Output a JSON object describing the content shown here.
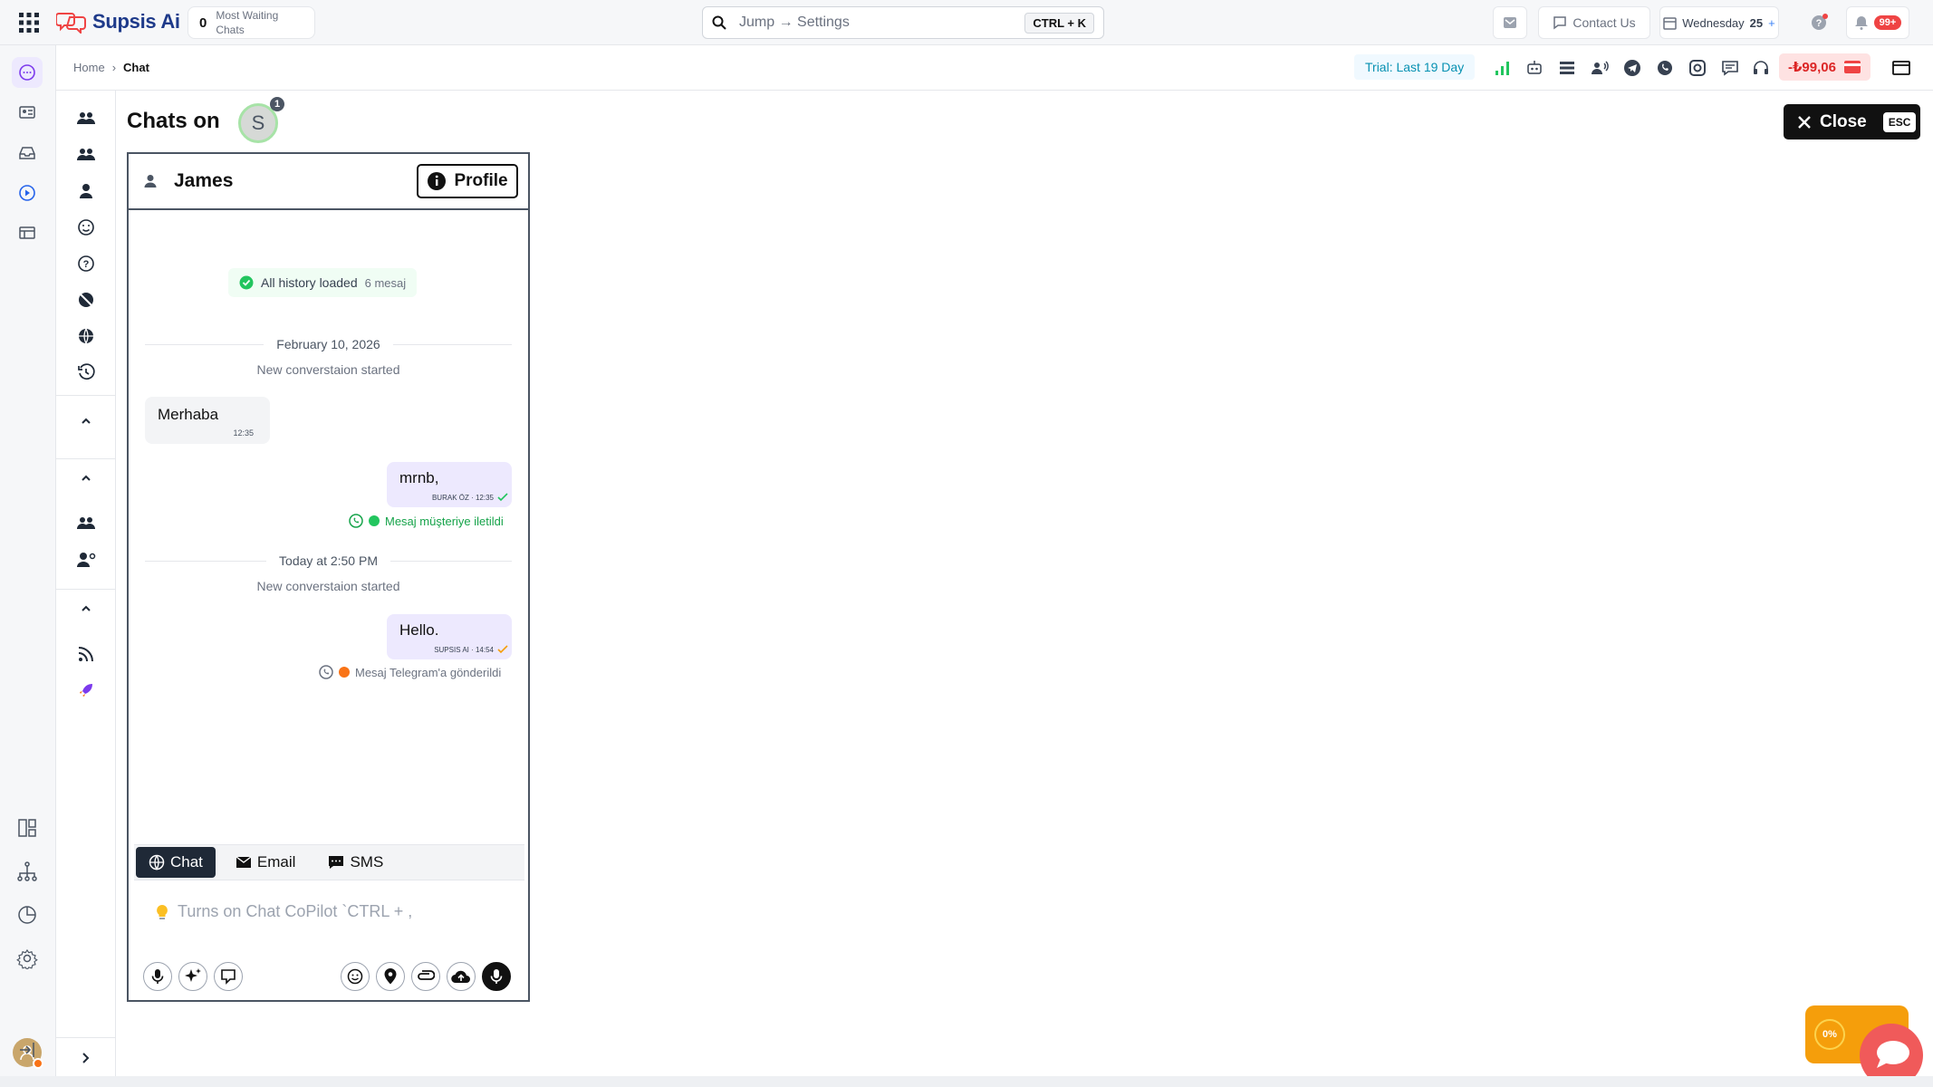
{
  "app": {
    "brand": "Supsis Ai"
  },
  "topbar": {
    "waiting_count": "0",
    "waiting_label": "Most Waiting Chats",
    "search_placeholder": "Jump → Settings",
    "search_shortcut": "CTRL + K",
    "contact_label": "Contact Us",
    "date_label": "Wednesday",
    "date_day": "25",
    "notifications_badge": "99+"
  },
  "breadcrumb": {
    "home": "Home",
    "current": "Chat"
  },
  "status": {
    "trial": "Trial: Last 19 Day",
    "credit": "-₺99,06"
  },
  "main": {
    "title": "Chats on",
    "agent_initial": "S",
    "agent_badge": "1",
    "close_label": "Close",
    "close_shortcut": "ESC"
  },
  "chat": {
    "contact_name": "James",
    "profile_label": "Profile",
    "history_text": "All history loaded",
    "history_count": "6 mesaj",
    "date_1": "February 10, 2026",
    "started_1": "New converstaion started",
    "msg_in_1": {
      "text": "Merhaba",
      "time": "12:35"
    },
    "msg_out_1": {
      "text": "mrnb,",
      "meta": "BURAK ÖZ · 12:35",
      "delivery": "Mesaj müşteriye iletildi"
    },
    "date_2": "Today at 2:50 PM",
    "started_2": "New converstaion started",
    "msg_out_2": {
      "text": "Hello.",
      "meta": "SUPSIS AI · 14:54",
      "delivery": "Mesaj Telegram'a gönderildi"
    }
  },
  "composer": {
    "tabs": [
      "Chat",
      "Email",
      "SMS"
    ],
    "placeholder": "Turns on Chat CoPilot `CTRL + ,"
  },
  "widget": {
    "progress": "0%"
  },
  "colors": {
    "brand": "#1e3a8a",
    "accent": "#7c3aed",
    "danger": "#ef4444",
    "trial": "#0891b2",
    "close": "#111111"
  }
}
